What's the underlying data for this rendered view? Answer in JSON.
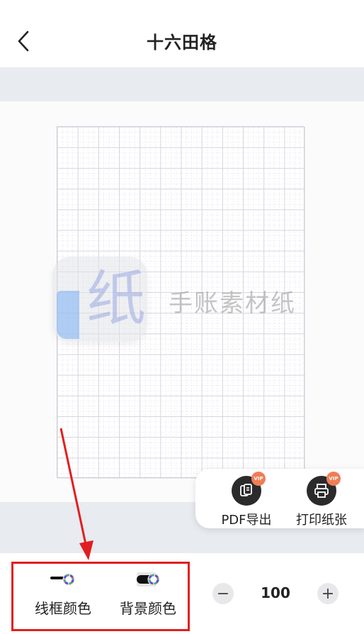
{
  "header": {
    "title": "十六田格",
    "back_icon": "chevron-left-icon"
  },
  "preview": {
    "watermark_char": "纸",
    "watermark_text": "手账素材纸",
    "grid": {
      "columns": 12,
      "rows": 17,
      "line_color": "#d9d3de"
    }
  },
  "actions": [
    {
      "label": "PDF导出",
      "icon": "pdf-export-icon",
      "badge": "VIP"
    },
    {
      "label": "打印纸张",
      "icon": "printer-icon",
      "badge": "VIP"
    }
  ],
  "toolbar": {
    "line_color_label": "线框颜色",
    "background_color_label": "背景颜色",
    "stepper": {
      "value": "100",
      "minus": "−",
      "plus": "+"
    }
  },
  "colors": {
    "highlight": "#e11f1f",
    "stage": "#e8ebef",
    "badge": "#f07d56"
  }
}
